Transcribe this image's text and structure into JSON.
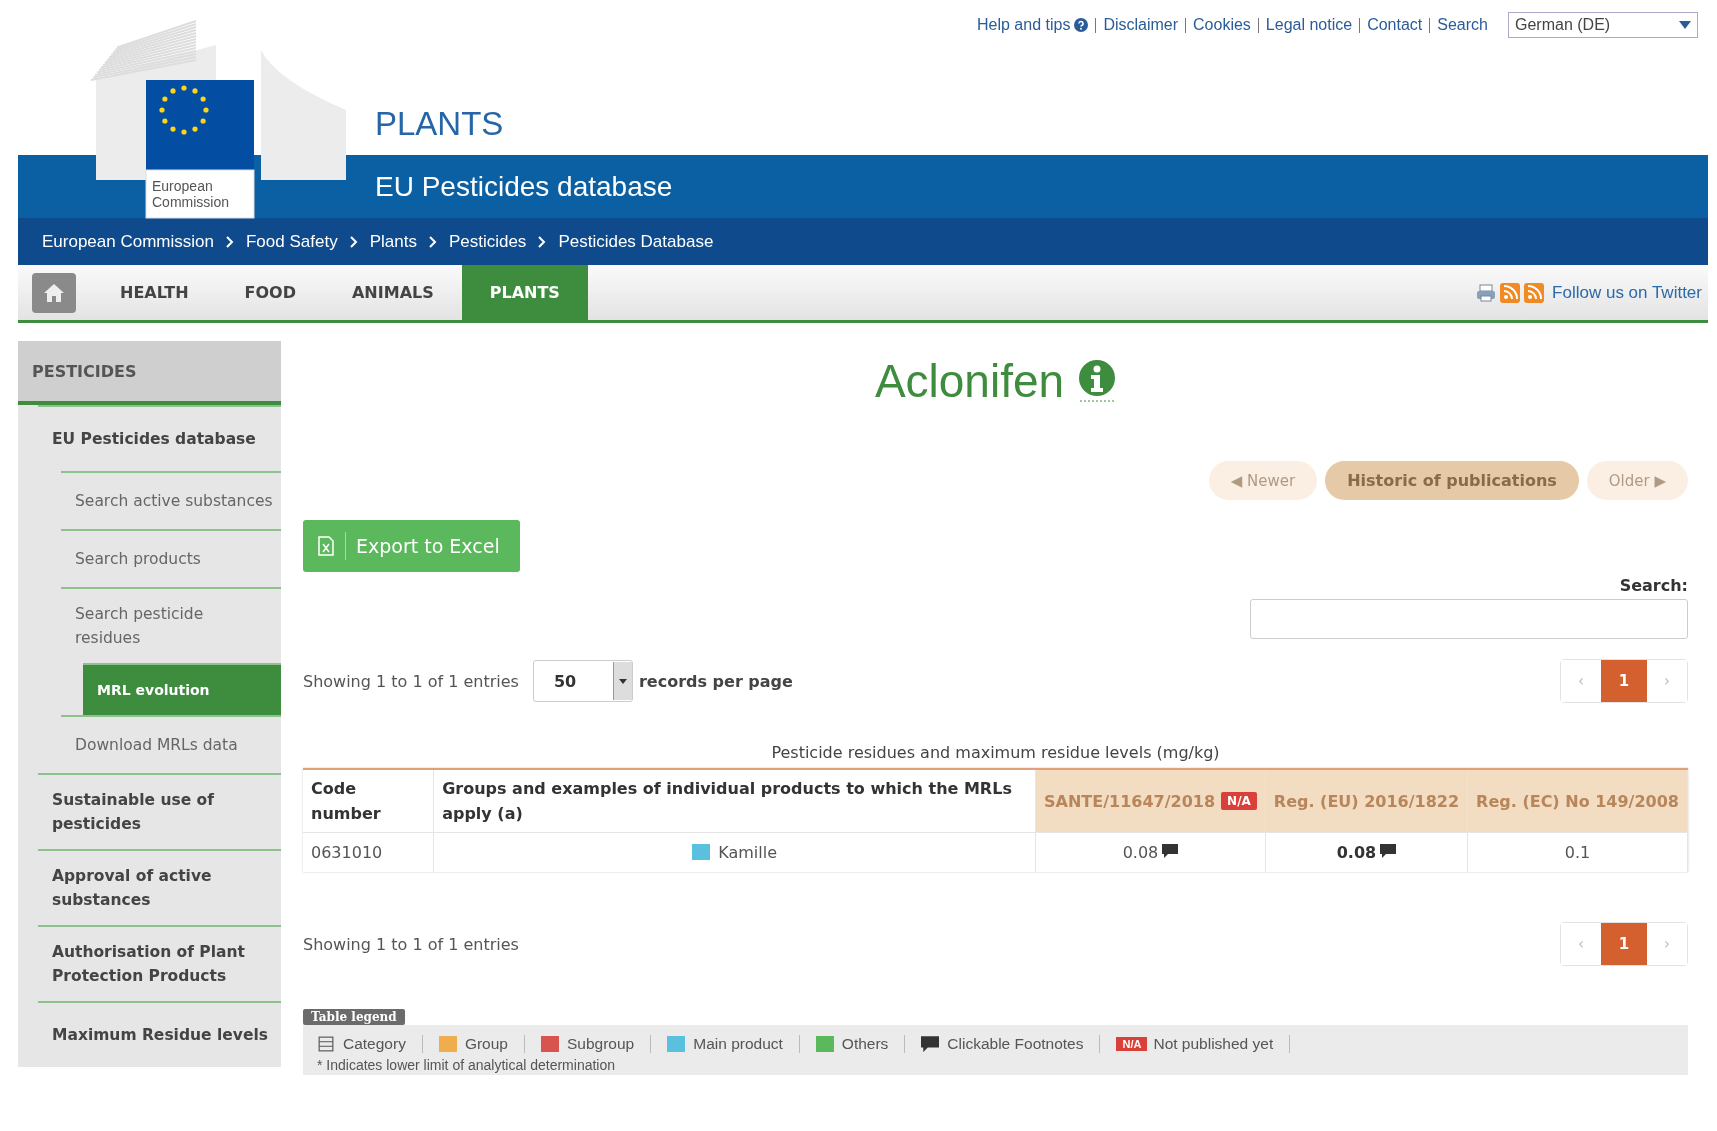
{
  "top_links": [
    {
      "label": "Help and tips",
      "help_icon": true
    },
    {
      "label": "Disclaimer",
      "help_icon": false
    },
    {
      "label": "Cookies",
      "help_icon": false
    },
    {
      "label": "Legal notice",
      "help_icon": false
    },
    {
      "label": "Contact",
      "help_icon": false
    },
    {
      "label": "Search",
      "help_icon": false
    }
  ],
  "language_select": {
    "value": "German (DE)"
  },
  "logo": {
    "line1": "European",
    "line2": "Commission"
  },
  "site_title": "PLANTS",
  "site_subtitle": "EU Pesticides database",
  "breadcrumb": [
    "European Commission",
    "Food Safety",
    "Plants",
    "Pesticides",
    "Pesticides Database"
  ],
  "nav_tabs": [
    {
      "label": "HEALTH",
      "selected": false
    },
    {
      "label": "FOOD",
      "selected": false
    },
    {
      "label": "ANIMALS",
      "selected": false
    },
    {
      "label": "PLANTS",
      "selected": true
    }
  ],
  "follow_link": "Follow us on Twitter",
  "sidebar": {
    "title": "PESTICIDES",
    "items": [
      {
        "label": "EU Pesticides database",
        "selected": false,
        "children": [
          {
            "label": "Search active substances",
            "selected": false
          },
          {
            "label": "Search products",
            "selected": false
          },
          {
            "label": "Search pesticide residues",
            "selected": false,
            "children": [
              {
                "label": "MRL evolution",
                "selected": true
              }
            ]
          },
          {
            "label": "Download MRLs data",
            "selected": false
          }
        ]
      },
      {
        "label": "Sustainable use of pesticides",
        "selected": false
      },
      {
        "label": "Approval of active substances",
        "selected": false
      },
      {
        "label": "Authorisation of Plant Protection Products",
        "selected": false
      },
      {
        "label": "Maximum Residue levels",
        "selected": false
      }
    ]
  },
  "page_title": "Aclonifen",
  "history_buttons": [
    {
      "label": "◀ Newer",
      "disabled": true
    },
    {
      "label": "Historic of publications",
      "disabled": false
    },
    {
      "label": "Older ▶",
      "disabled": true
    }
  ],
  "export_button": "Export to Excel",
  "search": {
    "label": "Search:"
  },
  "info_top": "Showing 1 to 1 of 1 entries",
  "page_size": {
    "value": "50",
    "label": "records per page"
  },
  "pagination_top": [
    {
      "label": "‹",
      "kind": "arrow",
      "selected": false
    },
    {
      "label": "1",
      "kind": "page",
      "selected": true
    },
    {
      "label": "›",
      "kind": "arrow",
      "selected": false
    }
  ],
  "table": {
    "caption": "Pesticide residues and maximum residue levels (mg/kg)",
    "columns": [
      {
        "label": "Code number",
        "kind": "plain"
      },
      {
        "label": "Groups and examples of individual products to which the MRLs apply (a)",
        "kind": "plain"
      },
      {
        "label": "SANTE/11647/2018",
        "kind": "regulation",
        "badge": "N/A"
      },
      {
        "label": "Reg. (EU) 2016/1822",
        "kind": "regulation"
      },
      {
        "label": "Reg. (EC) No 149/2008",
        "kind": "regulation"
      }
    ],
    "rows": [
      {
        "code": "0631010",
        "product": "Kamille",
        "color": "#5bc0de",
        "values": [
          {
            "text": "0.08",
            "footnote": true,
            "bold": false
          },
          {
            "text": "0.08",
            "footnote": true,
            "bold": true
          },
          {
            "text": "0.1",
            "footnote": false,
            "bold": false
          }
        ]
      }
    ]
  },
  "info_bottom": "Showing 1 to 1 of 1 entries",
  "pagination_bottom": [
    {
      "label": "‹",
      "kind": "arrow",
      "selected": false
    },
    {
      "label": "1",
      "kind": "page",
      "selected": true
    },
    {
      "label": "›",
      "kind": "arrow",
      "selected": false
    }
  ],
  "legend": {
    "title": "Table legend",
    "items": [
      {
        "kind": "category",
        "label": "Category"
      },
      {
        "kind": "swatch",
        "label": "Group",
        "color": "#f0ad4e"
      },
      {
        "kind": "swatch",
        "label": "Subgroup",
        "color": "#d9534f"
      },
      {
        "kind": "swatch",
        "label": "Main product",
        "color": "#5bc0de"
      },
      {
        "kind": "swatch",
        "label": "Others",
        "color": "#5cb85c"
      },
      {
        "kind": "footnote",
        "label": "Clickable Footnotes"
      },
      {
        "kind": "badge",
        "badge": "N/A",
        "label": "Not published yet"
      }
    ],
    "note": "* Indicates lower limit of analytical determination"
  }
}
